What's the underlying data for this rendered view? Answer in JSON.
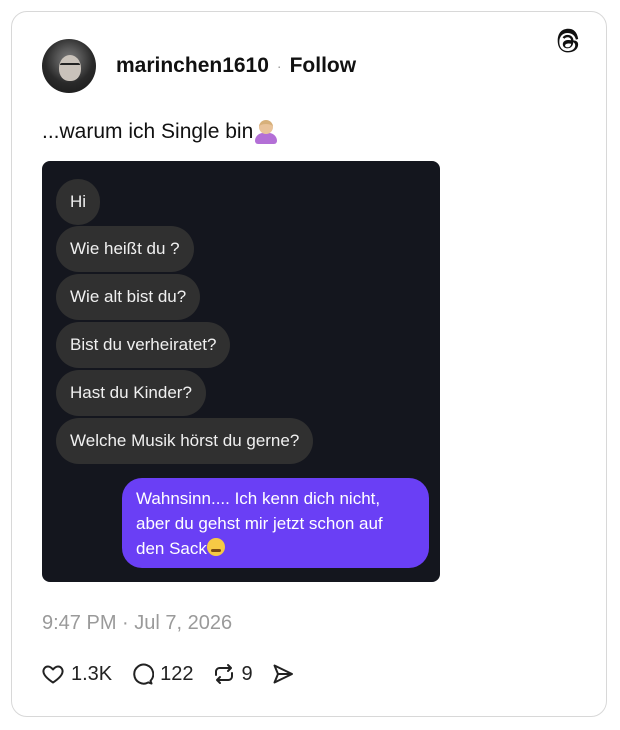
{
  "post": {
    "username": "marinchen1610",
    "separator": "·",
    "follow_label": "Follow",
    "text": "...warum ich Single bin",
    "timestamp": "9:47 PM · Jul 7, 2026"
  },
  "chat": {
    "incoming": [
      "Hi",
      "Wie heißt du ?",
      "Wie alt bist du?",
      "Bist du verheiratet?",
      "Hast du Kinder?",
      "Welche Musik hörst du gerne?"
    ],
    "outgoing": "Wahnsinn.... Ich kenn dich nicht, aber du gehst mir jetzt schon auf den Sack"
  },
  "actions": {
    "likes": "1.3K",
    "replies": "122",
    "reposts": "9"
  },
  "icons": {
    "logo": "threads-logo-icon",
    "like": "heart-icon",
    "reply": "comment-bubble-icon",
    "repost": "repost-icon",
    "share": "send-icon",
    "post_emoji": "woman-shrugging-emoji",
    "message_emoji": "face-with-steam-emoji"
  },
  "colors": {
    "chat_background": "#14161e",
    "incoming_bubble": "#303030",
    "outgoing_bubble": "#6a3ff5",
    "timestamp_text": "#9a9a9a"
  }
}
